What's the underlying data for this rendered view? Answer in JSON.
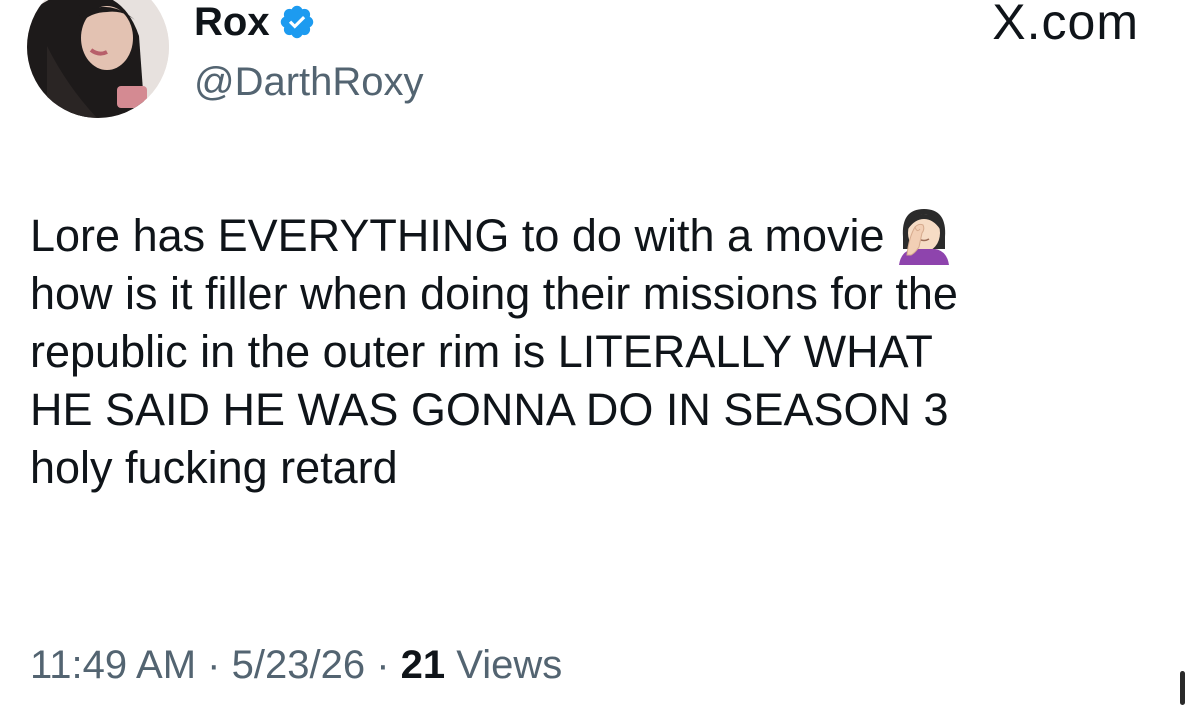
{
  "author": {
    "display_name": "Rox",
    "handle": "@DarthRoxy",
    "verified": true,
    "avatar_icon": "profile-photo"
  },
  "brand": {
    "label": "X.com"
  },
  "tweet": {
    "lines": [
      "Lore has EVERYTHING to do with a movie",
      "how is it filler when doing their missions for the",
      "republic in the outer rim is LITERALLY WHAT",
      "HE SAID HE WAS GONNA DO IN SEASON 3",
      "holy fucking retard"
    ],
    "emoji": "face-palm-woman-emoji"
  },
  "meta": {
    "time": "11:49 AM",
    "separator": "·",
    "date": "5/23/26",
    "views_count": "21",
    "views_label": "Views"
  },
  "colors": {
    "text": "#0f1419",
    "secondary": "#536471",
    "verified_blue": "#1d9bf0"
  }
}
